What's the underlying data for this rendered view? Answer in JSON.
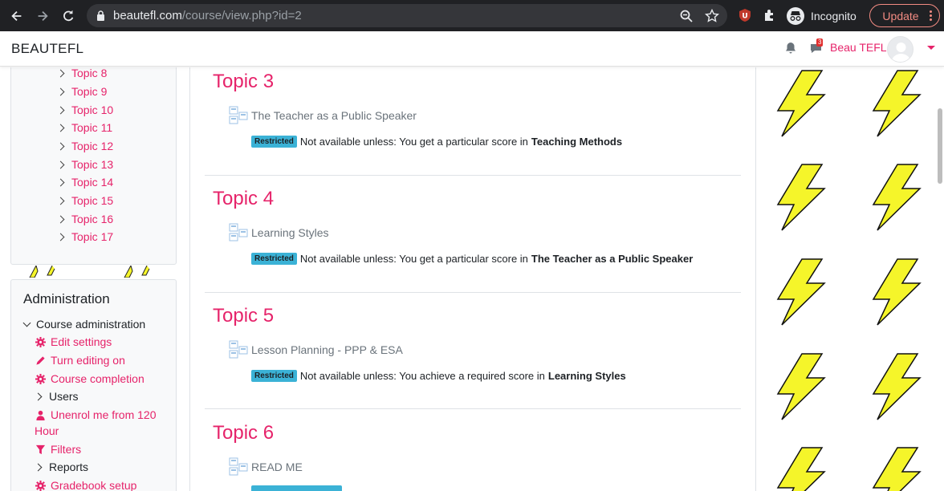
{
  "browser": {
    "url_host": "beautefl.com",
    "url_path": "/course/view.php?id=2",
    "profile_label": "Incognito",
    "update_label": "Update",
    "back_icon": "back-arrow-icon",
    "forward_icon": "forward-arrow-icon",
    "reload_icon": "reload-icon"
  },
  "header": {
    "brand": "BEAUTEFL",
    "message_count": "3",
    "username": "Beau TEFL"
  },
  "sidebar": {
    "topics": [
      "Topic 8",
      "Topic 9",
      "Topic 10",
      "Topic 11",
      "Topic 12",
      "Topic 13",
      "Topic 14",
      "Topic 15",
      "Topic 16",
      "Topic 17"
    ],
    "admin_title": "Administration",
    "course_admin": "Course administration",
    "edit_settings": "Edit settings",
    "turn_editing_on": "Turn editing on",
    "course_completion": "Course completion",
    "users": "Users",
    "unenrol_line1": "Unenrol me from 120",
    "unenrol_line2": "Hour",
    "filters": "Filters",
    "reports": "Reports",
    "gradebook_setup": "Gradebook setup"
  },
  "main": {
    "restricted_tag": "Restricted",
    "sections": [
      {
        "title": "Topic 3",
        "activity": "The Teacher as a Public Speaker",
        "condition": "Not available unless: You get a particular score in",
        "condition_target": "Teaching Methods"
      },
      {
        "title": "Topic 4",
        "activity": "Learning Styles",
        "condition": "Not available unless: You get a particular score in",
        "condition_target": "The Teacher as a Public Speaker"
      },
      {
        "title": "Topic 5",
        "activity": "Lesson Planning - PPP & ESA",
        "condition": "Not available unless: You achieve a required score in",
        "condition_target": "Learning Styles"
      },
      {
        "title": "Topic 6",
        "activity": "READ ME"
      }
    ]
  },
  "colors": {
    "accent": "#e6236a",
    "restricted_badge": "#3bb2d6",
    "bolt_fill": "#f5f52a"
  }
}
